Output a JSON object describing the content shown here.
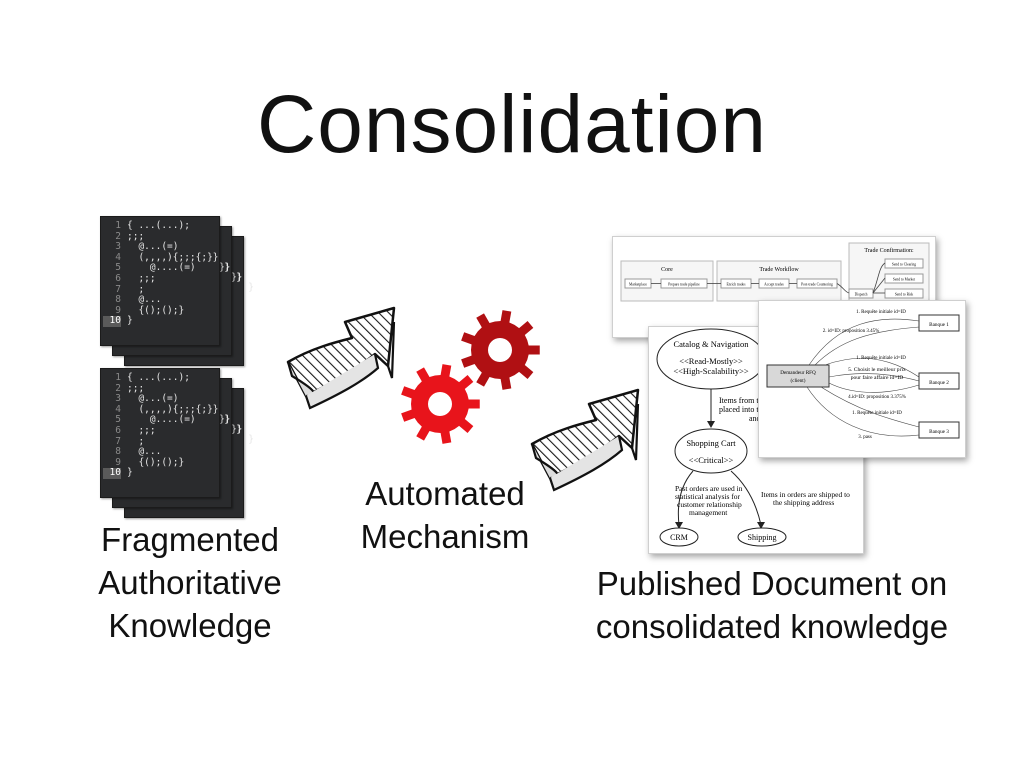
{
  "slide": {
    "title": "Consolidation",
    "left_label": [
      "Fragmented",
      "Authoritative",
      "Knowledge"
    ],
    "mid_label": [
      "Automated",
      "Mechanism"
    ],
    "right_label": [
      "Published Document on",
      "consolidated knowledge"
    ]
  },
  "code_snippet": {
    "lines": [
      {
        "n": "1",
        "t": "{ ...(...);"
      },
      {
        "n": "2",
        "t": ";;;"
      },
      {
        "n": "3",
        "t": "  @...(=)"
      },
      {
        "n": "4",
        "t": "  (,,,,){;;;{;}}"
      },
      {
        "n": "5",
        "t": "    @....(=)     }"
      },
      {
        "n": "6",
        "t": "  ;;;"
      },
      {
        "n": "7",
        "t": "  ;"
      },
      {
        "n": "8",
        "t": "  @..."
      },
      {
        "n": "9",
        "t": "  {();();}"
      },
      {
        "n": "10",
        "t": "}"
      }
    ]
  },
  "trade_diagram": {
    "groups": [
      "Core",
      "Trade Workflow",
      "Trade Confirmation:"
    ],
    "nodes": [
      "Marketplace",
      "Prepare trade pipeline",
      "Enrich trades",
      "Accept trades",
      "Post-trade Countering",
      "Dispatch",
      "Send to Clearing",
      "Send to Market",
      "Send to Risk"
    ]
  },
  "catalog_diagram": {
    "top_node": [
      "Catalog & Navigation",
      "<<Read-Mostly>>",
      "<<High-Scalability>>"
    ],
    "edge_top": [
      "Items from th",
      "placed into th",
      "and"
    ],
    "cart_node": [
      "Shopping Cart",
      "<<Critical>>"
    ],
    "edge_left": [
      "Past orders are used in",
      "statistical analysis for",
      "customer relationship",
      "management"
    ],
    "edge_right": [
      "Items in orders are shipped to",
      "the shipping address"
    ],
    "crm": "CRM",
    "shipping": "Shipping"
  },
  "rfq_diagram": {
    "client_node": [
      "Demandeur RFQ",
      "(client)"
    ],
    "banks": [
      "Banque 1",
      "Banque 2",
      "Banque 3"
    ],
    "messages": [
      "1. Requête initiale id=ID",
      "2. id=ID: proposition 3.45%",
      "1. Requête initiale id=ID",
      "5. Choisit le meilleur prix",
      "pour faire affaire id=ID",
      "4.id=ID: proposition 3.375%",
      "1. Requête initiale id=ID",
      "3. pass"
    ]
  },
  "colors": {
    "gear_front": "#e8141b",
    "gear_back": "#b01013",
    "code_bg": "#2a2b2d"
  }
}
